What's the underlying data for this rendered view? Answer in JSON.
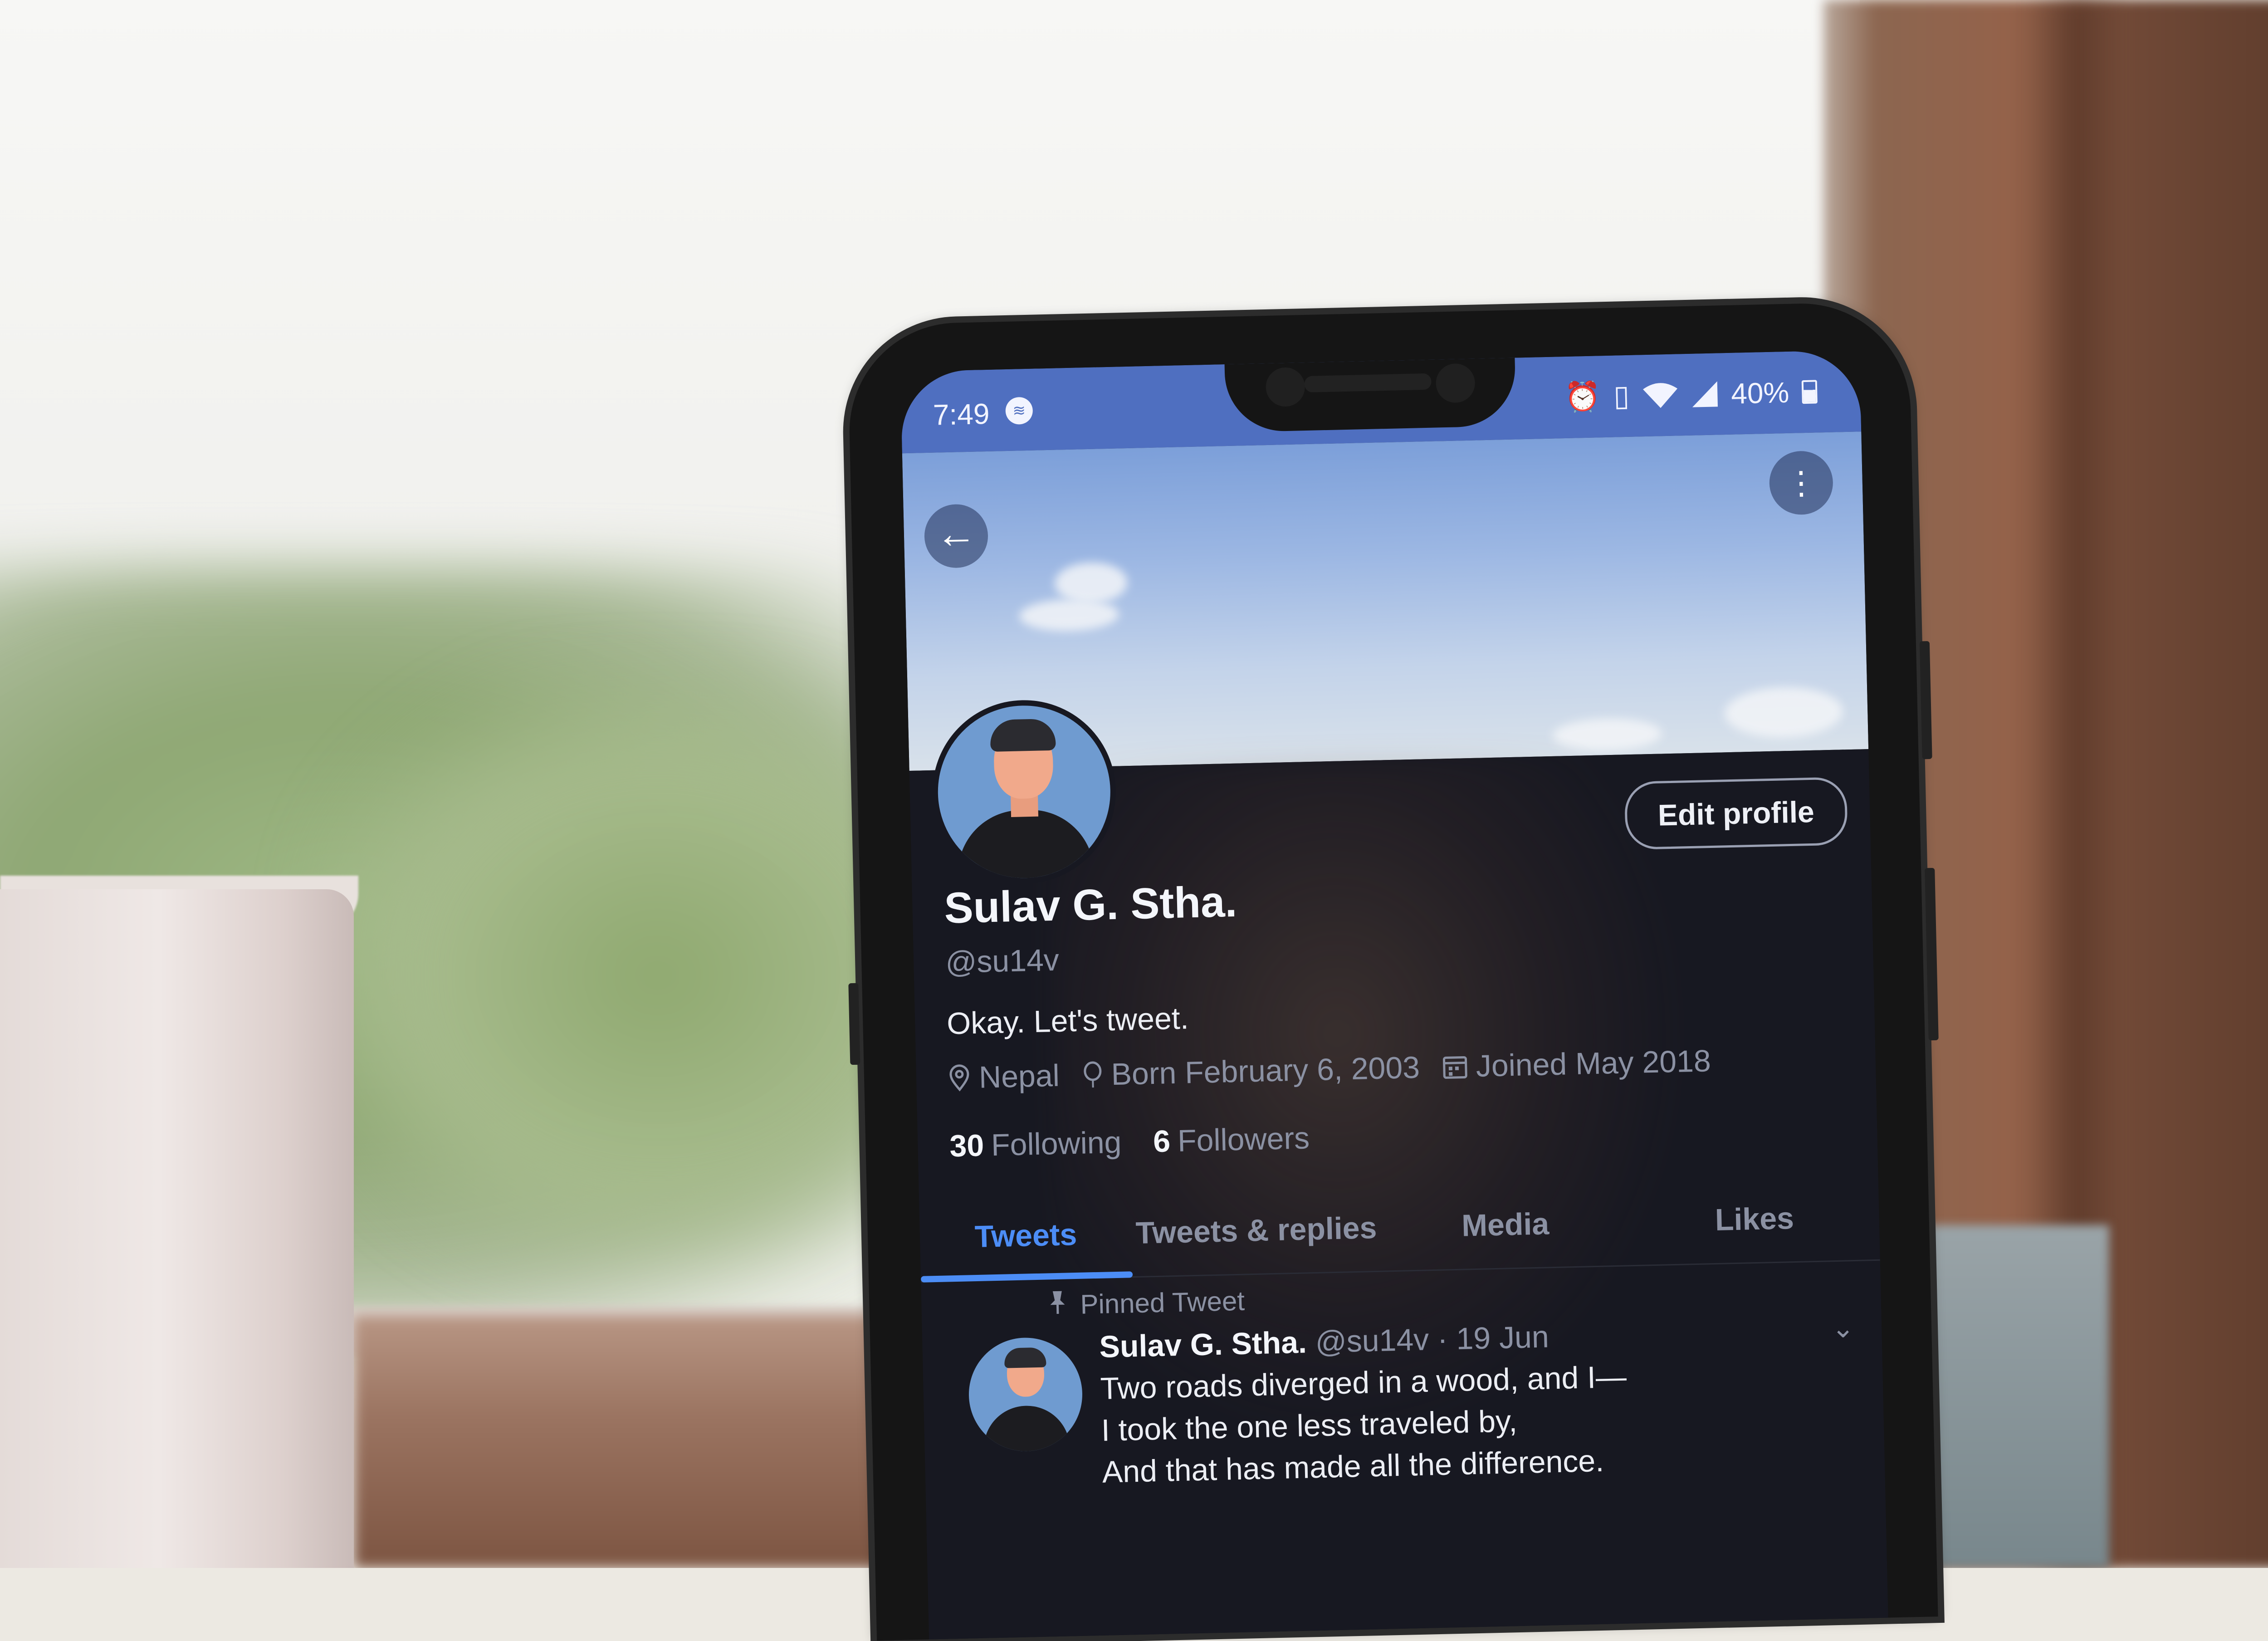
{
  "status_bar": {
    "time": "7:49",
    "battery": "40%"
  },
  "profile": {
    "name": "Sulav G. Stha.",
    "handle": "@su14v",
    "bio": "Okay. Let's tweet.",
    "location": "Nepal",
    "born": "Born February 6, 2003",
    "joined": "Joined May 2018",
    "following_count": "30",
    "following_label": "Following",
    "followers_count": "6",
    "followers_label": "Followers",
    "edit_label": "Edit profile"
  },
  "tabs": [
    "Tweets",
    "Tweets & replies",
    "Media",
    "Likes"
  ],
  "active_tab": "Tweets",
  "pinned_tweet": {
    "label": "Pinned Tweet",
    "author": "Sulav G. Stha.",
    "meta": "@su14v · 19 Jun",
    "lines": [
      "Two roads diverged in a wood, and I—",
      "I took the one less traveled by,",
      "And that has made all the difference."
    ]
  },
  "icons": {
    "back": "arrow-left-icon",
    "more": "more-vertical-icon",
    "location": "map-pin-icon",
    "birthday": "balloon-icon",
    "joined": "calendar-icon",
    "pin": "pushpin-icon",
    "caret": "chevron-down-icon"
  },
  "colors": {
    "accent": "#4c8df6",
    "status_bar": "#4f6fc0",
    "background": "#171821"
  }
}
